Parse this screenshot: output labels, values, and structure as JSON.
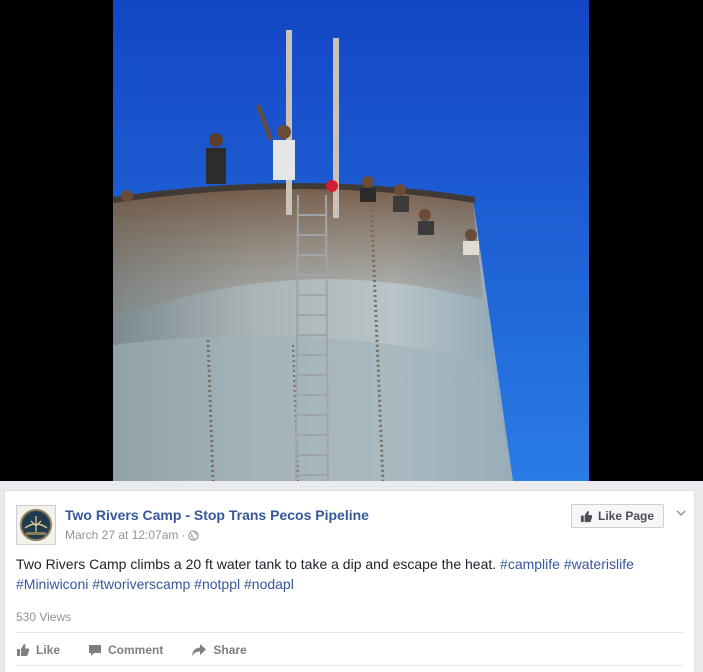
{
  "post": {
    "page_name": "Two Rivers Camp - Stop Trans Pecos Pipeline",
    "timestamp": "March 27 at 12:07am",
    "separator": "·",
    "text_main": "Two Rivers Camp climbs a 20 ft water tank to take a dip and escape the heat.",
    "hashtags_line1": [
      "#camplife",
      "#waterislife"
    ],
    "hashtags_line2": [
      "#Miniwiconi",
      "#tworiverscamp",
      "#notppl",
      "#nodapl"
    ],
    "views": "530 Views"
  },
  "buttons": {
    "like_page": "Like Page"
  },
  "actions": {
    "like": "Like",
    "comment": "Comment",
    "share": "Share"
  },
  "icons": {
    "privacy": "globe-icon",
    "like_page": "thumbs-up-icon",
    "more": "chevron-down-icon"
  },
  "colors": {
    "link": "#365899",
    "text": "#1d2129",
    "muted": "#90949c",
    "sky": "#1f63d6"
  }
}
